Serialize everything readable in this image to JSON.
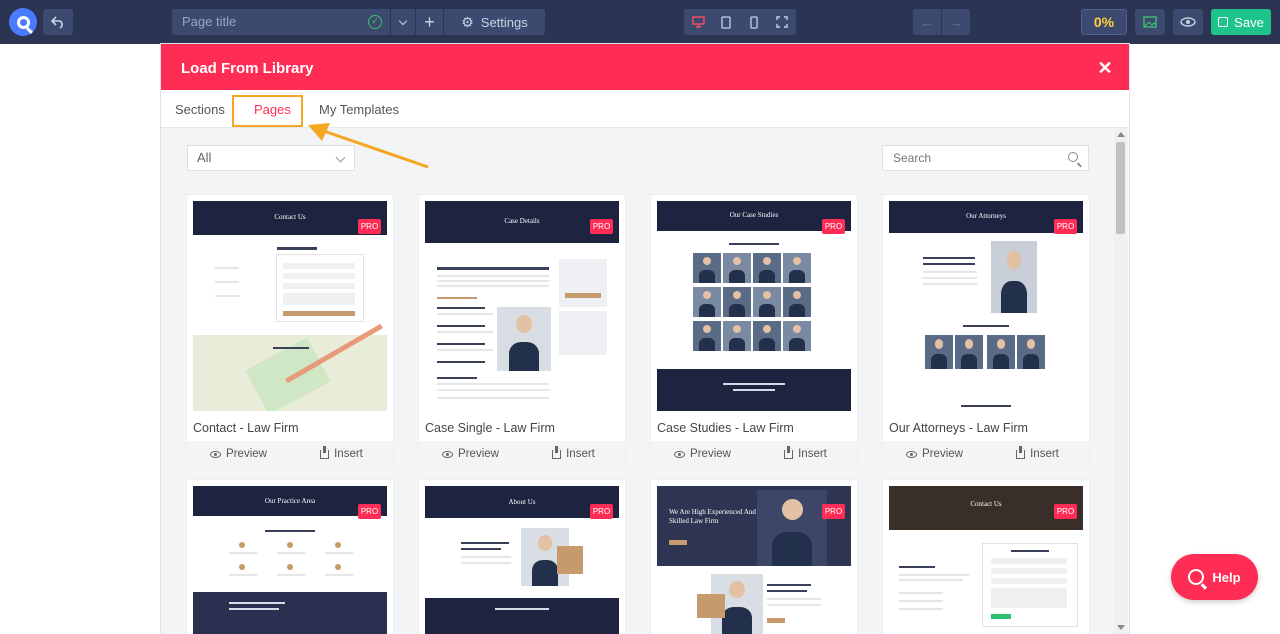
{
  "toolbar": {
    "page_title_placeholder": "Page title",
    "settings_label": "Settings",
    "percent": "0%",
    "save_label": "Save",
    "icons": [
      "undo-icon",
      "check-icon",
      "chevron-down-icon",
      "plus-icon",
      "gear-icon",
      "desktop-icon",
      "tablet-icon",
      "mobile-icon",
      "fullscreen-icon",
      "arrow-left-icon",
      "arrow-right-icon",
      "image-icon",
      "eye-icon",
      "save-icon"
    ]
  },
  "modal": {
    "title": "Load From Library",
    "tabs": [
      {
        "label": "Sections"
      },
      {
        "label": "Pages"
      },
      {
        "label": "My Templates"
      }
    ],
    "active_tab": "Pages",
    "filter_value": "All",
    "search_placeholder": "Search",
    "pro_badge": "PRO",
    "preview_label": "Preview",
    "insert_label": "Insert",
    "cards": [
      {
        "title": "Contact - Law Firm",
        "header": "Contact Us"
      },
      {
        "title": "Case Single - Law Firm",
        "header": "Case Details"
      },
      {
        "title": "Case Studies - Law Firm",
        "header": "Our Case Studies"
      },
      {
        "title": "Our Attorneys - Law Firm",
        "header": "Our Attorneys"
      },
      {
        "header": "Our Practice Area"
      },
      {
        "header": "About Us"
      },
      {
        "header": "We Are High Experienced And Skilled Law Firm"
      },
      {
        "header": "Contact Us"
      }
    ]
  },
  "help_label": "Help",
  "colors": {
    "toolbar": "#2b3553",
    "accent": "#ff2d55",
    "save": "#1fc48a",
    "percent": "#ffd23f",
    "highlight": "#f5a623"
  }
}
